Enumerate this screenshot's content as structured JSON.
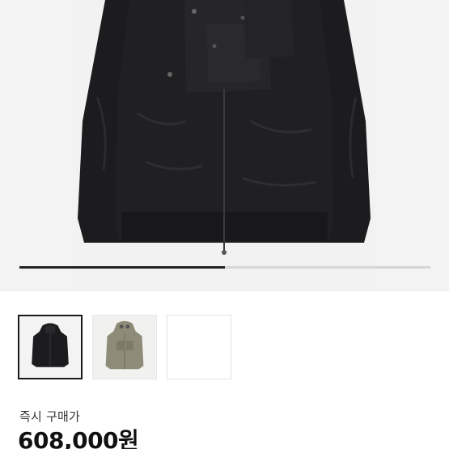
{
  "product": {
    "image_alt": "black-hooded-jacket",
    "gallery_progress": 0.5,
    "thumbnails": [
      {
        "name": "black-jacket",
        "active": true
      },
      {
        "name": "olive-goggle-jacket",
        "active": false
      },
      {
        "name": "empty",
        "active": false
      }
    ],
    "price_label": "즉시 구매가",
    "price_value": "608,000원"
  },
  "colors": {
    "jacket": "#1b1b1d",
    "olive": "#8e8c78",
    "progress_track": "#d6d6d6",
    "progress_fill": "#222222"
  }
}
